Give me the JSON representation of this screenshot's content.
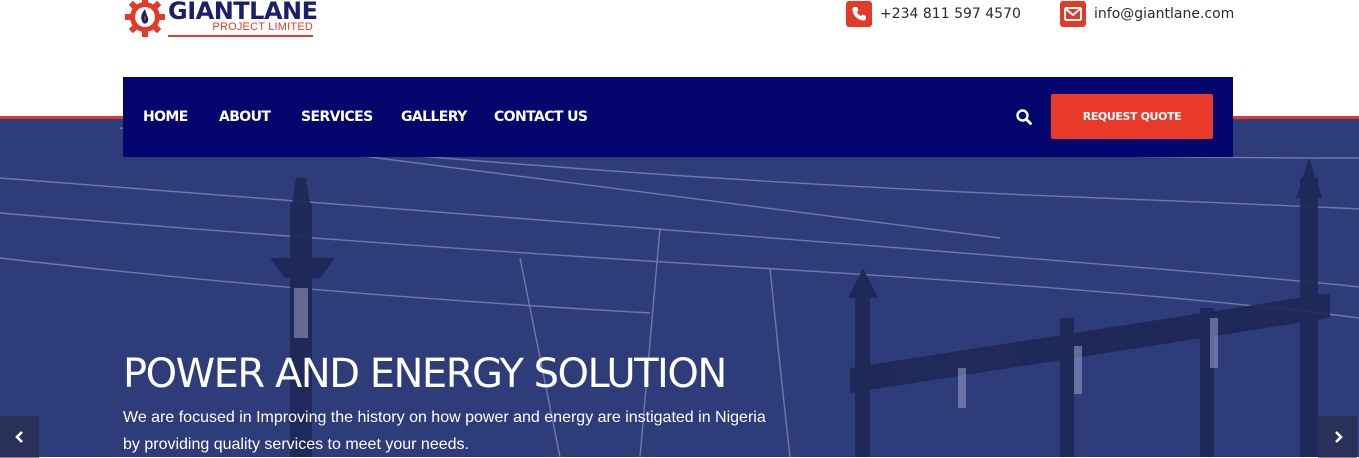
{
  "brand": {
    "name": "GIANTLANE",
    "tagline": "PROJECT LIMITED",
    "primary_color": "#05056e",
    "accent_color": "#e8392b"
  },
  "contact": {
    "phone": "+234 811 597 4570",
    "phone_icon": "phone-icon",
    "email": "info@giantlane.com",
    "email_icon": "envelope-icon"
  },
  "nav": {
    "items": [
      {
        "label": "HOME"
      },
      {
        "label": "ABOUT"
      },
      {
        "label": "SERVICES"
      },
      {
        "label": "GALLERY"
      },
      {
        "label": "CONTACT US"
      }
    ],
    "search_icon": "search-icon",
    "cta_label": "REQUEST QUOTE"
  },
  "hero": {
    "title": "POWER AND ENERGY SOLUTION",
    "text": "We are focused in Improving the history on how power and energy are instigated in Nigeria by providing quality services to meet your needs.",
    "prev_icon": "chevron-left-icon",
    "next_icon": "chevron-right-icon"
  }
}
